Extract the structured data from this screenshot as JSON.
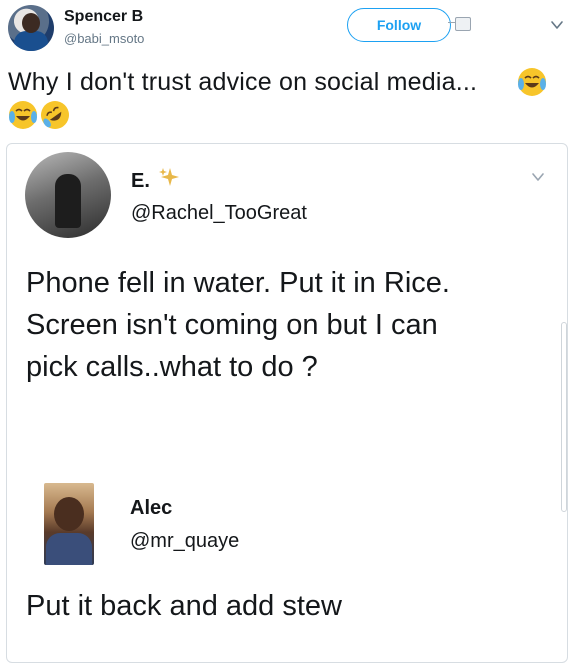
{
  "header": {
    "display_name": "Spencer B",
    "handle": "@babi_msoto",
    "follow_label": "Follow"
  },
  "tweet": {
    "text": "Why I don't trust advice on social media..."
  },
  "quoted": {
    "name": "E.",
    "handle": "@Rachel_TooGreat",
    "text_lines": [
      "Phone fell in water. Put it in Rice.",
      "Screen isn't coming on but I can",
      "pick calls..what to do ?"
    ]
  },
  "reply": {
    "name": "Alec",
    "handle": "@mr_quaye",
    "text": "Put it back and add stew"
  },
  "icons": {
    "caret": "chevron-down-icon",
    "emoji_1": "face-with-tears-of-joy",
    "emoji_2": "face-with-tears-of-joy",
    "emoji_3": "rolling-on-the-floor-laughing",
    "sparkle": "sparkles"
  },
  "colors": {
    "accent": "#1da1f2",
    "secondary_text": "#657786",
    "emoji_yellow": "#f7c52a"
  }
}
